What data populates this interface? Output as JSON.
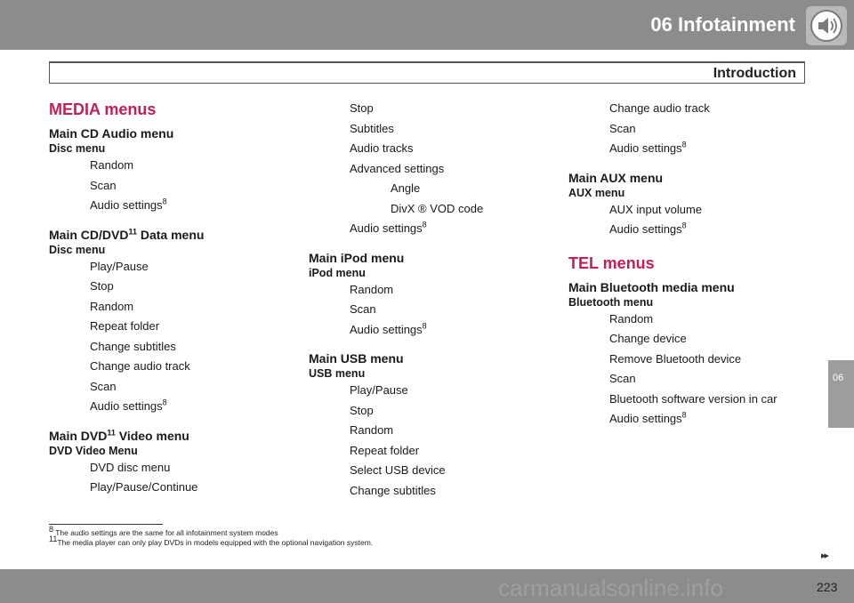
{
  "header": {
    "chapter": "06  Infotainment",
    "section": "Introduction"
  },
  "side_tab": "06",
  "page_number": "223",
  "next_indicator": "▸▸",
  "watermark": "carmanualsonline.info",
  "col1": {
    "group": "MEDIA menus",
    "menus": [
      {
        "title": "Main CD Audio menu",
        "title_sup": "",
        "title_rest": "",
        "subtitle": "Disc menu",
        "items": [
          "Random",
          "Scan"
        ],
        "last_item": "Audio settings",
        "last_sup": "8"
      },
      {
        "title": "Main CD/DVD",
        "title_sup": "11",
        "title_rest": " Data menu",
        "subtitle": "Disc menu",
        "items": [
          "Play/Pause",
          "Stop",
          "Random",
          "Repeat folder",
          "Change subtitles",
          "Change audio track",
          "Scan"
        ],
        "last_item": "Audio settings",
        "last_sup": "8"
      },
      {
        "title": "Main DVD",
        "title_sup": "11",
        "title_rest": " Video menu",
        "subtitle": "DVD Video Menu",
        "items": [
          "DVD disc menu",
          "Play/Pause/Continue"
        ]
      }
    ]
  },
  "col2": {
    "continued_items": [
      "Stop",
      "Subtitles",
      "Audio tracks",
      "Advanced settings"
    ],
    "advanced_sub": [
      "Angle",
      "DivX ®  VOD code"
    ],
    "after_item": "Audio settings",
    "after_sup": "8",
    "menus": [
      {
        "title": "Main iPod menu",
        "subtitle": "iPod menu",
        "items": [
          "Random",
          "Scan"
        ],
        "last_item": "Audio settings",
        "last_sup": "8"
      },
      {
        "title": "Main USB menu",
        "subtitle": "USB menu",
        "items": [
          "Play/Pause",
          "Stop",
          "Random",
          "Repeat folder",
          "Select USB device",
          "Change subtitles"
        ]
      }
    ]
  },
  "col3": {
    "continued_items": [
      "Change audio track",
      "Scan"
    ],
    "continued_last": "Audio settings",
    "continued_sup": "8",
    "aux": {
      "title": "Main AUX menu",
      "subtitle": "AUX menu",
      "items": [
        "AUX input volume"
      ],
      "last_item": "Audio settings",
      "last_sup": "8"
    },
    "group": "TEL menus",
    "bt": {
      "title": "Main Bluetooth media menu",
      "subtitle": "Bluetooth menu",
      "items": [
        "Random",
        "Change device",
        "Remove Bluetooth device",
        "Scan",
        "Bluetooth software version in car"
      ],
      "last_item": "Audio settings",
      "last_sup": "8"
    }
  },
  "footnotes": [
    {
      "num": "8",
      "text": " The audio settings are the same for all infotainment system modes"
    },
    {
      "num": "11",
      "text": "The media player can only play DVDs in models equipped with the optional navigation system."
    }
  ],
  "colors": {
    "header_gray": "#8c8c8c",
    "accent": "#c41e5a"
  },
  "icons": {
    "header": "speaker-icon"
  }
}
